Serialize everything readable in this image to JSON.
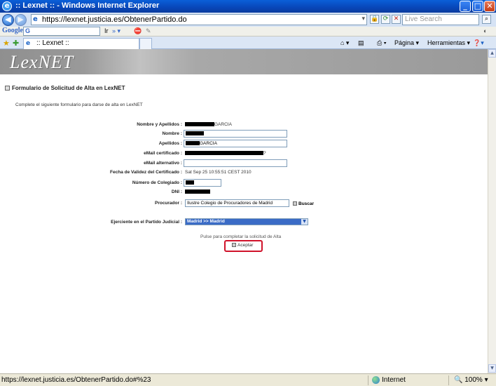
{
  "window": {
    "title": ":: Lexnet :: - Windows Internet Explorer",
    "minimize": "_",
    "maximize": "□",
    "close": "✕"
  },
  "addressbar": {
    "back": "◀",
    "forward": "▶",
    "url": "https://lexnet.justicia.es/ObtenerPartido.do",
    "search_placeholder": "Live Search"
  },
  "googlebar": {
    "logo": "Google",
    "search_value": "G",
    "go_label": "Ir"
  },
  "tabs": [
    {
      "label": ":: Lexnet ::"
    }
  ],
  "commandbar": {
    "page_label": "Página",
    "tools_label": "Herramientas"
  },
  "page": {
    "brand": "LexNET",
    "form_title": "Formulario de Solicitud de Alta en LexNET",
    "intro": "Complete el siguiente formulario para darse de alta en LexNET",
    "fields": {
      "nombre_apellidos": {
        "label": "Nombre y Apellidos :",
        "value_suffix": "GARCIA"
      },
      "nombre": {
        "label": "Nombre :"
      },
      "apellidos": {
        "label": "Apellidos :",
        "value_suffix": "GARCIA"
      },
      "email_cert": {
        "label": "eMail certificado :",
        "value_suffix": "?"
      },
      "email_alt": {
        "label": "eMail alternativo :",
        "value": ""
      },
      "fecha_validez": {
        "label": "Fecha de Validez del Certificado :",
        "value": "Sat Sep 25 10:55:51 CEST 2010"
      },
      "num_colegiado": {
        "label": "Número de Colegiado :"
      },
      "dni": {
        "label": "DNI :"
      },
      "procurador": {
        "label": "Procurador :",
        "value": "Ilustre Colegio de Procuradores de Madrid"
      },
      "partido": {
        "label": "Ejerciente en el Partido Judicial :",
        "value": "Madrid >> Madrid"
      }
    },
    "buscar_label": "Buscar",
    "submit_hint": "Pulse para completar la solicitud de Alta",
    "aceptar_label": "Aceptar"
  },
  "statusbar": {
    "url": "https://lexnet.justicia.es/ObtenerPartido.do#%23",
    "zone": "Internet",
    "zoom": "100%"
  },
  "colors": {
    "highlight_ring": "#d0122a",
    "select_bg": "#3a6bc6",
    "titlebar": "#0846b8"
  }
}
